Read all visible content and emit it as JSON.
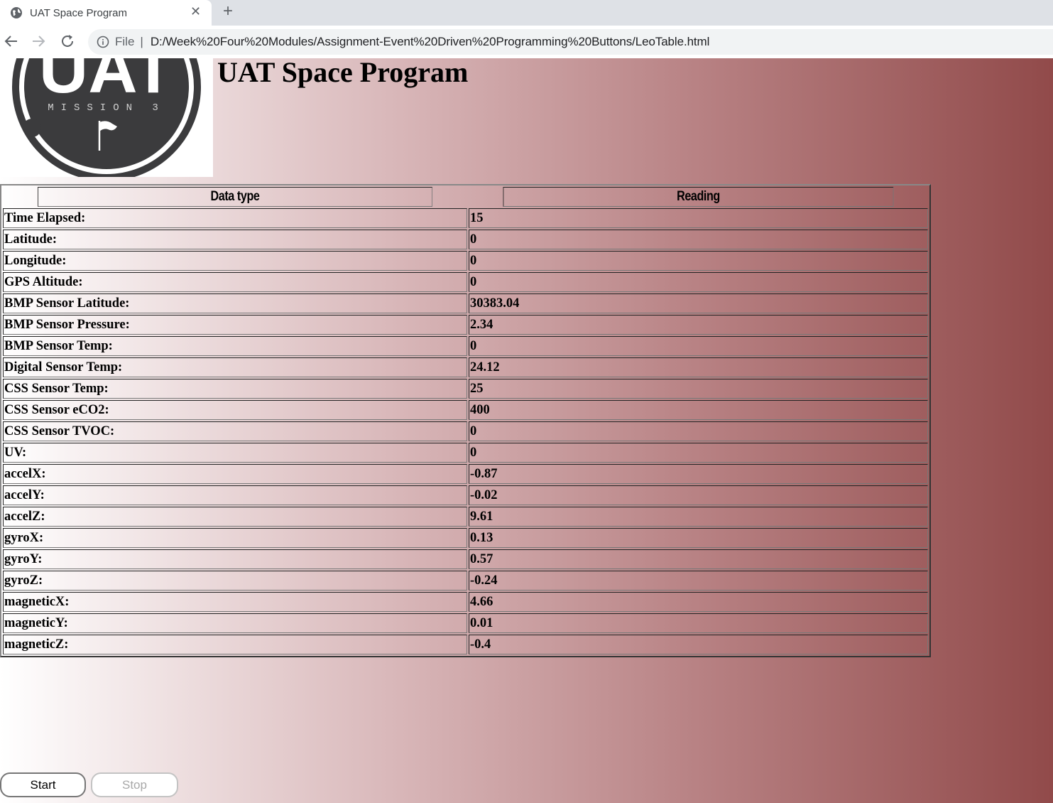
{
  "browser": {
    "tab_title": "UAT Space Program",
    "address_scheme": "File",
    "address_url": "D:/Week%20Four%20Modules/Assignment-Event%20Driven%20Programming%20Buttons/LeoTable.html"
  },
  "page": {
    "title": "UAT Space Program",
    "logo_text": "UAT",
    "logo_subtext": "MISSION 3"
  },
  "table": {
    "headers": [
      "Data type",
      "Reading"
    ],
    "rows": [
      {
        "label": "Time Elapsed:",
        "value": "15"
      },
      {
        "label": "Latitude:",
        "value": "0"
      },
      {
        "label": "Longitude:",
        "value": "0"
      },
      {
        "label": "GPS Altitude:",
        "value": "0"
      },
      {
        "label": "BMP Sensor Latitude:",
        "value": "30383.04"
      },
      {
        "label": "BMP Sensor Pressure:",
        "value": "2.34"
      },
      {
        "label": "BMP Sensor Temp:",
        "value": "0"
      },
      {
        "label": "Digital Sensor Temp:",
        "value": "24.12"
      },
      {
        "label": "CSS Sensor Temp:",
        "value": "25"
      },
      {
        "label": "CSS Sensor eCO2:",
        "value": "400"
      },
      {
        "label": "CSS Sensor TVOC:",
        "value": "0"
      },
      {
        "label": "UV:",
        "value": "0"
      },
      {
        "label": "accelX:",
        "value": "-0.87"
      },
      {
        "label": "accelY:",
        "value": "-0.02"
      },
      {
        "label": "accelZ:",
        "value": "9.61"
      },
      {
        "label": "gyroX:",
        "value": "0.13"
      },
      {
        "label": "gyroY:",
        "value": "0.57"
      },
      {
        "label": "gyroZ:",
        "value": "-0.24"
      },
      {
        "label": "magneticX:",
        "value": "4.66"
      },
      {
        "label": "magneticY:",
        "value": "0.01"
      },
      {
        "label": "magneticZ:",
        "value": "-0.4"
      }
    ]
  },
  "buttons": {
    "start_label": "Start",
    "stop_label": "Stop"
  },
  "colors": {
    "gradient_start": "#ffffff",
    "gradient_end": "#914a4a",
    "logo_dark": "#3b3b3d"
  }
}
